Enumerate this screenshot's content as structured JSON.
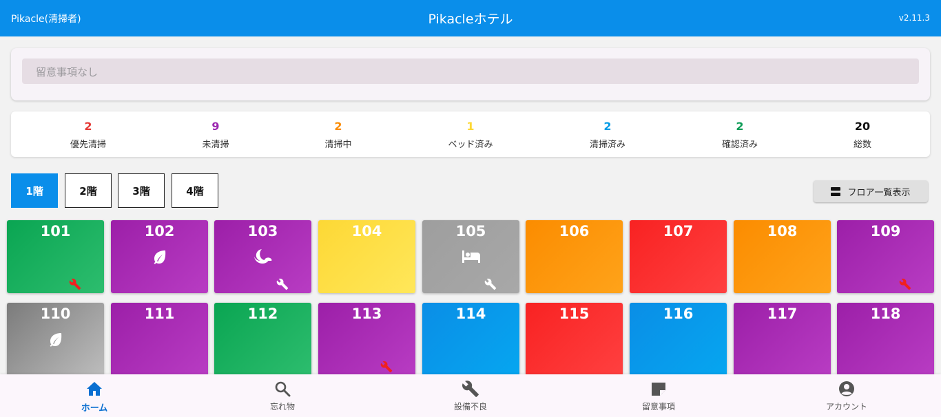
{
  "header": {
    "left_label": "Pikacle(清掃者)",
    "title": "Pikacleホテル",
    "version": "v2.11.3"
  },
  "notice": {
    "placeholder": "留意事項なし"
  },
  "stats": [
    {
      "value": "2",
      "label": "優先清掃",
      "color": "#e53935"
    },
    {
      "value": "9",
      "label": "未清掃",
      "color": "#9c27b0"
    },
    {
      "value": "2",
      "label": "清掃中",
      "color": "#fb8c00"
    },
    {
      "value": "1",
      "label": "ベッド済み",
      "color": "#fdd835"
    },
    {
      "value": "2",
      "label": "清掃済み",
      "color": "#039be5"
    },
    {
      "value": "2",
      "label": "確認済み",
      "color": "#0f9d58"
    },
    {
      "value": "20",
      "label": "総数",
      "color": "#111111"
    }
  ],
  "floors": [
    "1階",
    "2階",
    "3階",
    "4階"
  ],
  "active_floor": "1階",
  "floor_list_button": "フロア一覧表示",
  "rooms": [
    {
      "number": "101",
      "status": "green",
      "icon": "",
      "wrench": "red"
    },
    {
      "number": "102",
      "status": "purple",
      "icon": "leaf",
      "wrench": ""
    },
    {
      "number": "103",
      "status": "purple",
      "icon": "moon",
      "wrench": "white"
    },
    {
      "number": "104",
      "status": "yellow",
      "icon": "",
      "wrench": ""
    },
    {
      "number": "105",
      "status": "gray",
      "icon": "bed",
      "wrench": "white"
    },
    {
      "number": "106",
      "status": "orange",
      "icon": "",
      "wrench": ""
    },
    {
      "number": "107",
      "status": "red",
      "icon": "",
      "wrench": ""
    },
    {
      "number": "108",
      "status": "orange",
      "icon": "",
      "wrench": ""
    },
    {
      "number": "109",
      "status": "purple",
      "icon": "",
      "wrench": "red"
    },
    {
      "number": "110",
      "status": "darkgray",
      "icon": "leaf",
      "wrench": ""
    },
    {
      "number": "111",
      "status": "purple",
      "icon": "",
      "wrench": ""
    },
    {
      "number": "112",
      "status": "green",
      "icon": "",
      "wrench": ""
    },
    {
      "number": "113",
      "status": "purple",
      "icon": "",
      "wrench": "red"
    },
    {
      "number": "114",
      "status": "blue",
      "icon": "",
      "wrench": ""
    },
    {
      "number": "115",
      "status": "red",
      "icon": "",
      "wrench": ""
    },
    {
      "number": "116",
      "status": "blue",
      "icon": "",
      "wrench": ""
    },
    {
      "number": "117",
      "status": "purple",
      "icon": "",
      "wrench": ""
    },
    {
      "number": "118",
      "status": "purple",
      "icon": "",
      "wrench": ""
    }
  ],
  "status_colors": {
    "green": [
      "#0aa552",
      "#2dbd6e"
    ],
    "purple": [
      "#9c1fa8",
      "#b83cc3"
    ],
    "yellow": [
      "#fdd835",
      "#ffe75a"
    ],
    "gray": [
      "#9e9e9e",
      "#a8a8a8"
    ],
    "darkgray": [
      "#7b7b7b",
      "#bdbdbd"
    ],
    "orange": [
      "#fb8c00",
      "#ffa31a"
    ],
    "red": [
      "#f82222",
      "#ff4040"
    ],
    "blue": [
      "#0a8ee6",
      "#06a6f0"
    ]
  },
  "bottom_nav": [
    {
      "label": "ホーム",
      "icon": "home-icon",
      "active": true
    },
    {
      "label": "忘れ物",
      "icon": "search-icon",
      "active": false
    },
    {
      "label": "設備不良",
      "icon": "wrench-icon",
      "active": false
    },
    {
      "label": "留意事項",
      "icon": "note-icon",
      "active": false
    },
    {
      "label": "アカウント",
      "icon": "account-icon",
      "active": false
    }
  ]
}
